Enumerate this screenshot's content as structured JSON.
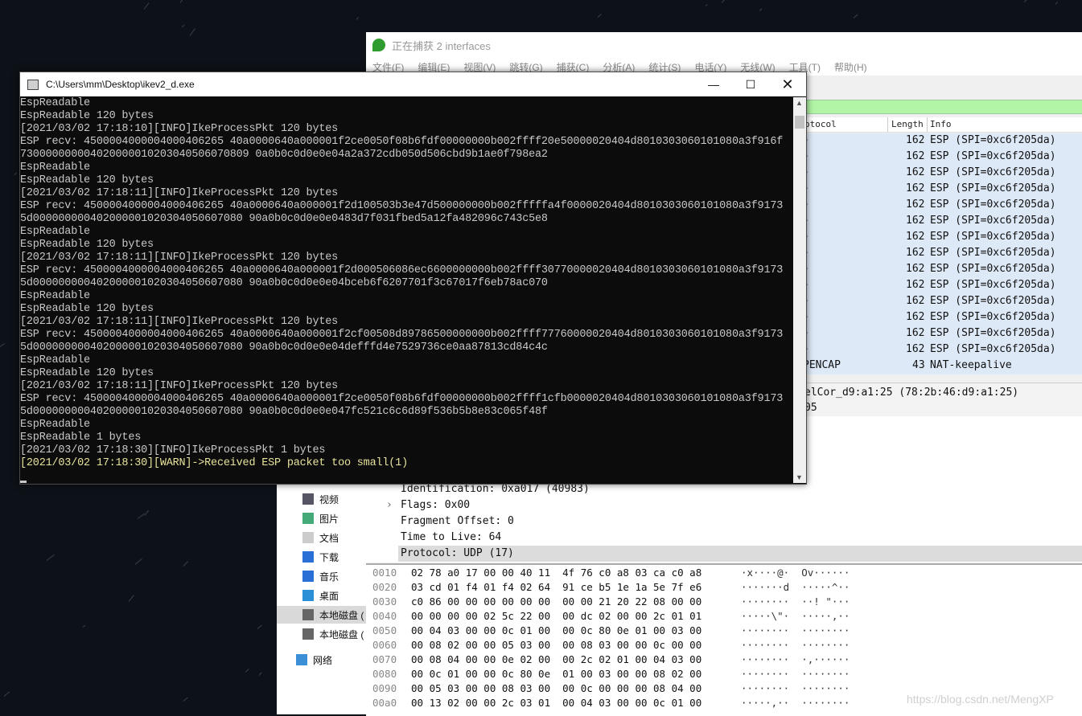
{
  "wireshark": {
    "title": "正在捕获 2 interfaces",
    "menu": [
      "文件(F)",
      "编辑(E)",
      "视图(V)",
      "跳转(G)",
      "捕获(C)",
      "分析(A)",
      "统计(S)",
      "电话(Y)",
      "无线(W)",
      "工具(T)",
      "帮助(H)"
    ],
    "columns": {
      "protocol": "otocol",
      "length": "Length",
      "info": "Info"
    },
    "packets": [
      {
        "length": "162",
        "info": "ESP (SPI=0xc6f205da)"
      },
      {
        "length": "162",
        "info": "ESP (SPI=0xc6f205da)"
      },
      {
        "length": "162",
        "info": "ESP (SPI=0xc6f205da)"
      },
      {
        "length": "162",
        "info": "ESP (SPI=0xc6f205da)"
      },
      {
        "length": "162",
        "info": "ESP (SPI=0xc6f205da)"
      },
      {
        "length": "162",
        "info": "ESP (SPI=0xc6f205da)"
      },
      {
        "length": "162",
        "info": "ESP (SPI=0xc6f205da)"
      },
      {
        "length": "162",
        "info": "ESP (SPI=0xc6f205da)"
      },
      {
        "length": "162",
        "info": "ESP (SPI=0xc6f205da)"
      },
      {
        "length": "162",
        "info": "ESP (SPI=0xc6f205da)"
      },
      {
        "length": "162",
        "info": "ESP (SPI=0xc6f205da)"
      },
      {
        "length": "162",
        "info": "ESP (SPI=0xc6f205da)"
      },
      {
        "length": "162",
        "info": "ESP (SPI=0xc6f205da)"
      },
      {
        "length": "162",
        "info": "ESP (SPI=0xc6f205da)"
      }
    ],
    "keepalive": {
      "protocol": "PENCAP",
      "length": "43",
      "info": "NAT-keepalive"
    },
    "detail_top": [
      "elCor_d9:a1:25 (78:2b:46:d9:a1:25)",
      "05"
    ],
    "detail_lines": [
      "Identification: 0xa017 (40983)",
      "Flags: 0x00",
      "Fragment Offset: 0",
      "Time to Live: 64",
      "Protocol: UDP (17)"
    ],
    "hex_rows": [
      {
        "offset": "0010",
        "bytes": "02 78 a0 17 00 00 40 11  4f 76 c0 a8 03 ca c0 a8",
        "ascii": "·x····@·  Ov······"
      },
      {
        "offset": "0020",
        "bytes": "03 cd 01 f4 01 f4 02 64  91 ce b5 1e 1a 5e 7f e6",
        "ascii": "·······d  ·····^··"
      },
      {
        "offset": "0030",
        "bytes": "c0 86 00 00 00 00 00 00  00 00 21 20 22 08 00 00",
        "ascii": "········  ··! \"···"
      },
      {
        "offset": "0040",
        "bytes": "00 00 00 00 02 5c 22 00  00 dc 02 00 00 2c 01 01",
        "ascii": "·····\\\"·  ·····,··"
      },
      {
        "offset": "0050",
        "bytes": "00 04 03 00 00 0c 01 00  00 0c 80 0e 01 00 03 00",
        "ascii": "········  ········"
      },
      {
        "offset": "0060",
        "bytes": "00 08 02 00 00 05 03 00  00 08 03 00 00 0c 00 00",
        "ascii": "········  ········"
      },
      {
        "offset": "0070",
        "bytes": "00 08 04 00 00 0e 02 00  00 2c 02 01 00 04 03 00",
        "ascii": "········  ·,······"
      },
      {
        "offset": "0080",
        "bytes": "00 0c 01 00 00 0c 80 0e  01 00 03 00 00 08 02 00",
        "ascii": "········  ········"
      },
      {
        "offset": "0090",
        "bytes": "00 05 03 00 00 08 03 00  00 0c 00 00 00 08 04 00",
        "ascii": "········  ········"
      },
      {
        "offset": "00a0",
        "bytes": "00 13 02 00 00 2c 03 01  00 04 03 00 00 0c 01 00",
        "ascii": "·····,··  ········"
      }
    ]
  },
  "explorer": {
    "items": [
      "视频",
      "图片",
      "文档",
      "下载",
      "音乐",
      "桌面",
      "本地磁盘 (",
      "本地磁盘 (",
      "网络"
    ]
  },
  "console": {
    "title": "C:\\Users\\mm\\Desktop\\ikev2_d.exe",
    "lines": [
      "EspReadable",
      "EspReadable 120 bytes",
      "[2021/03/02 17:18:10][INFO]IkeProcessPkt 120 bytes",
      "ESP recv: 4500004000004000406265 40a0000640a000001f2ce0050f08b6fdf00000000b002ffff20e50000020404d8010303060101080a3f916f",
      "730000000004020000010203040506070809 0a0b0c0d0e0e04a2a372cdb050d506cbd9b1ae0f798ea2",
      "EspReadable",
      "EspReadable 120 bytes",
      "[2021/03/02 17:18:11][INFO]IkeProcessPkt 120 bytes",
      "ESP recv: 4500004000004000406265 40a0000640a000001f2d100503b3e47d500000000b002fffffa4f0000020404d8010303060101080a3f9173",
      "5d000000000402000001020304050607080 90a0b0c0d0e0e0483d7f031fbed5a12fa482096c743c5e8",
      "EspReadable",
      "EspReadable 120 bytes",
      "[2021/03/02 17:18:11][INFO]IkeProcessPkt 120 bytes",
      "ESP recv: 4500004000004000406265 40a0000640a000001f2d000506086ec6600000000b002ffff30770000020404d8010303060101080a3f9173",
      "5d000000000402000001020304050607080 90a0b0c0d0e0e04bceb6f6207701f3c67017f6eb78ac070",
      "EspReadable",
      "EspReadable 120 bytes",
      "[2021/03/02 17:18:11][INFO]IkeProcessPkt 120 bytes",
      "ESP recv: 4500004000004000406265 40a0000640a000001f2cf00508d89786500000000b002ffff77760000020404d8010303060101080a3f9173",
      "5d000000000402000001020304050607080 90a0b0c0d0e0e04defffd4e7529736ce0aa87813cd84c4c",
      "EspReadable",
      "EspReadable 120 bytes",
      "[2021/03/02 17:18:11][INFO]IkeProcessPkt 120 bytes",
      "ESP recv: 4500004000004000406265 40a0000640a000001f2ce0050f08b6fdf00000000b002ffff1cfb0000020404d8010303060101080a3f9173",
      "5d000000000402000001020304050607080 90a0b0c0d0e0e047fc521c6c6d89f536b5b8e83c065f48f",
      "EspReadable",
      "EspReadable 1 bytes",
      "[2021/03/02 17:18:30][INFO]IkeProcessPkt 1 bytes"
    ],
    "warn_line": "[2021/03/02 17:18:30][WARN]->Received ESP packet too small(1)"
  },
  "watermark": "https://blog.csdn.net/MengXP"
}
